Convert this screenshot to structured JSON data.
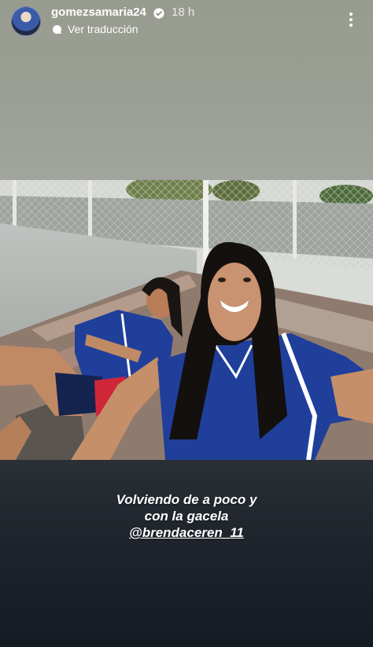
{
  "header": {
    "username": "gomezsamaria24",
    "time": "18 h",
    "translate_label": "Ver traducción"
  },
  "caption": {
    "line1": "Volviendo de a poco y",
    "line2": "con la gacela",
    "mention": "@brendaceren_11"
  },
  "colors": {
    "top_background": "#9a9e94",
    "bottom_background": "#161b23",
    "jersey": "#1f3f9a"
  },
  "icons": {
    "verified": "verified-badge-icon",
    "translate": "translate-bubble-icon",
    "more": "more-vertical-icon"
  }
}
